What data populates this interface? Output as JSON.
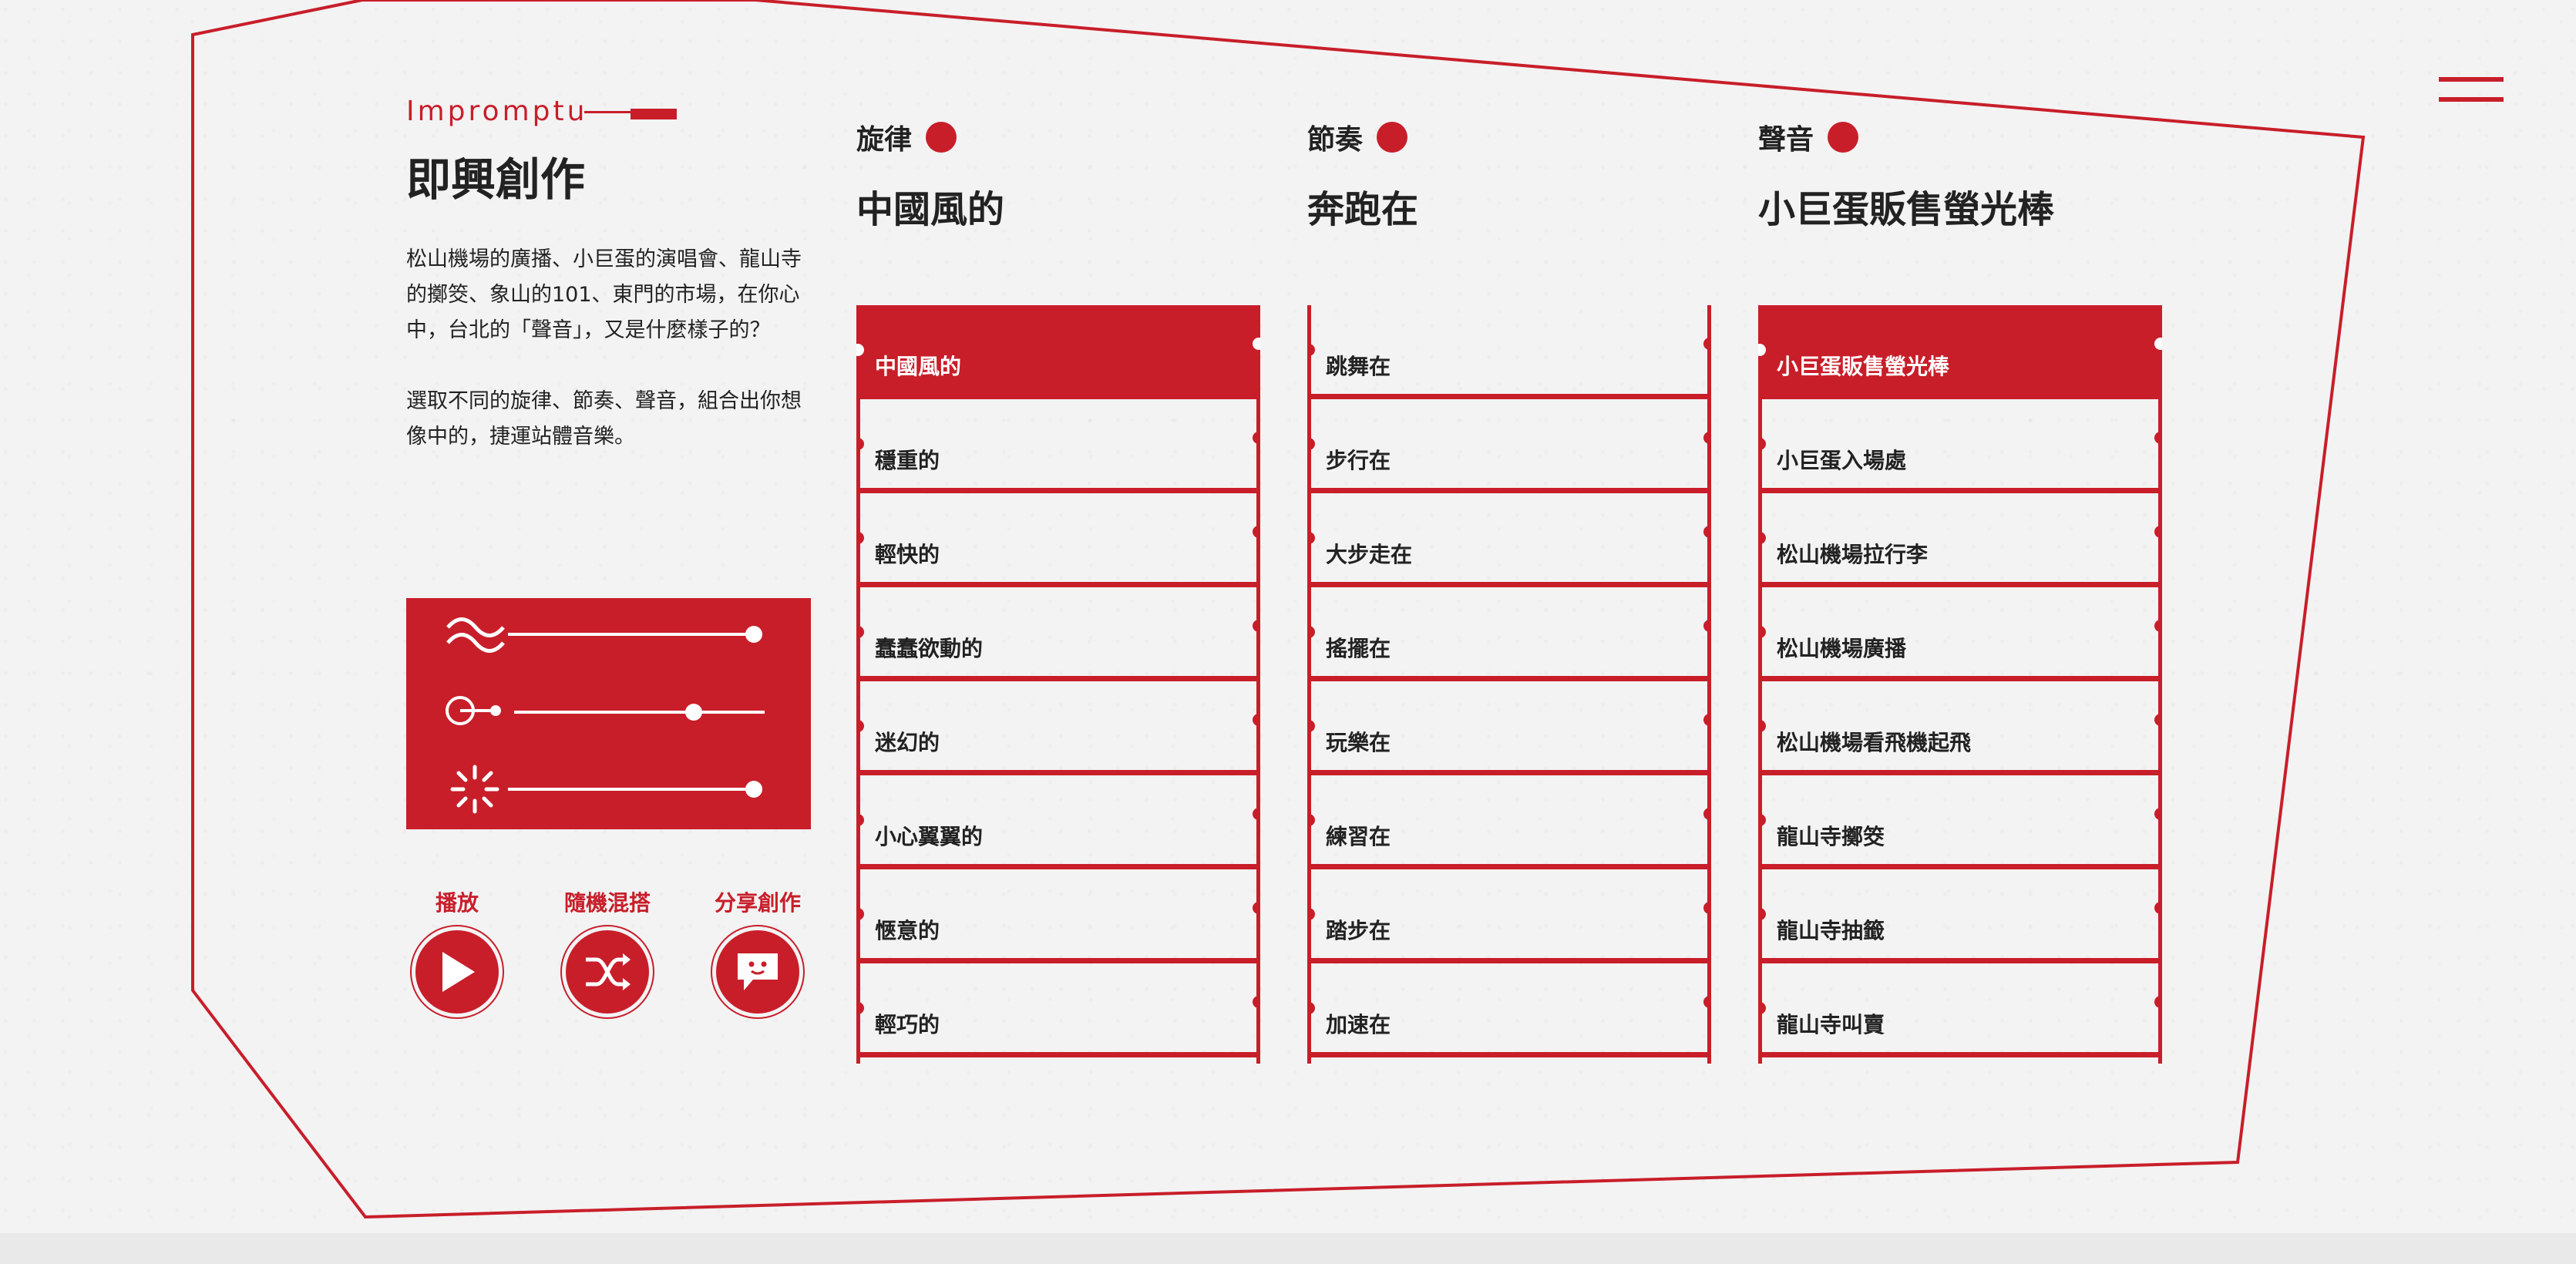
{
  "intro": {
    "eyebrow": "Impromptu",
    "title": "即興創作",
    "paragraph1": "松山機場的廣播、小巨蛋的演唱會、龍山寺的擲筊、象山的101、東門的市場，在你心中，台北的「聲音」，又是什麼樣子的？",
    "paragraph2": "選取不同的旋律、節奏、聲音，組合出你想像中的，捷運站體音樂。"
  },
  "mixer": {
    "sliders": [
      {
        "icon": "wave-icon",
        "level": 1.0
      },
      {
        "icon": "pulse-icon",
        "level": 0.75
      },
      {
        "icon": "burst-icon",
        "level": 1.0
      }
    ]
  },
  "controls": [
    {
      "label": "播放",
      "icon": "play-icon"
    },
    {
      "label": "隨機混搭",
      "icon": "shuffle-icon"
    },
    {
      "label": "分享創作",
      "icon": "chat-icon"
    }
  ],
  "columns": [
    {
      "heading": "旋律",
      "current": "中國風的",
      "selected_index": 0,
      "items": [
        "中國風的",
        "穩重的",
        "輕快的",
        "蠢蠢欲動的",
        "迷幻的",
        "小心翼翼的",
        "愜意的",
        "輕巧的"
      ]
    },
    {
      "heading": "節奏",
      "current": "奔跑在",
      "selected_index": -1,
      "items": [
        "跳舞在",
        "步行在",
        "大步走在",
        "搖擺在",
        "玩樂在",
        "練習在",
        "踏步在",
        "加速在"
      ]
    },
    {
      "heading": "聲音",
      "current": "小巨蛋販售螢光棒",
      "selected_index": 0,
      "items": [
        "小巨蛋販售螢光棒",
        "小巨蛋入場處",
        "松山機場拉行李",
        "松山機場廣播",
        "松山機場看飛機起飛",
        "龍山寺擲筊",
        "龍山寺抽籤",
        "龍山寺叫賣"
      ]
    }
  ],
  "colors": {
    "accent": "#c81e2a",
    "background": "#f3f3f3",
    "text": "#222222"
  }
}
